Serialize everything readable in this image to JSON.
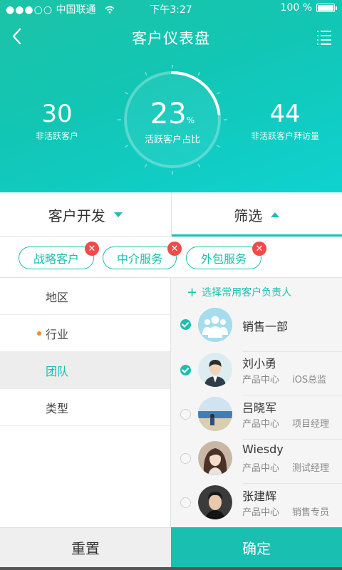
{
  "status_bar": {
    "signal_dots": "●●●○○",
    "carrier": "中国联通",
    "time": "下午3:27",
    "battery": "100 %"
  },
  "nav": {
    "title": "客户仪表盘",
    "back_icon": "back-icon",
    "menu_icon": "list-menu-icon"
  },
  "dashboard": {
    "left": {
      "value": "30",
      "label": "非活跃客户"
    },
    "center": {
      "value": "23",
      "unit": "%",
      "label": "活跃客户占比",
      "progress": 0.23
    },
    "right": {
      "value": "44",
      "label": "非活跃客户拜访量"
    }
  },
  "tabs": [
    {
      "label": "客户开发",
      "arrow": "down"
    },
    {
      "label": "筛选",
      "arrow": "up",
      "active": true
    }
  ],
  "chips": [
    {
      "label": "战略客户"
    },
    {
      "label": "中介服务"
    },
    {
      "label": "外包服务"
    }
  ],
  "filter_categories": [
    {
      "label": "地区"
    },
    {
      "label": "行业",
      "marked": true
    },
    {
      "label": "团队",
      "selected": true
    },
    {
      "label": "类型"
    }
  ],
  "owner_list": {
    "add_label": "选择常用客户负责人",
    "people": [
      {
        "name": "销售一部",
        "dept": "",
        "role": "",
        "checked": true
      },
      {
        "name": "刘小勇",
        "dept": "产品中心",
        "role": "iOS总监",
        "checked": true
      },
      {
        "name": "吕晓军",
        "dept": "产品中心",
        "role": "项目经理",
        "checked": false
      },
      {
        "name": "Wiesdy",
        "dept": "产品中心",
        "role": "测试经理",
        "checked": false
      },
      {
        "name": "张建辉",
        "dept": "产品中心",
        "role": "销售专员",
        "checked": false
      }
    ]
  },
  "actions": {
    "reset": "重置",
    "confirm": "确定"
  },
  "colors": {
    "accent": "#19bfb0",
    "remove_badge": "#f04a4a",
    "marker_dot": "#f08a2b"
  }
}
